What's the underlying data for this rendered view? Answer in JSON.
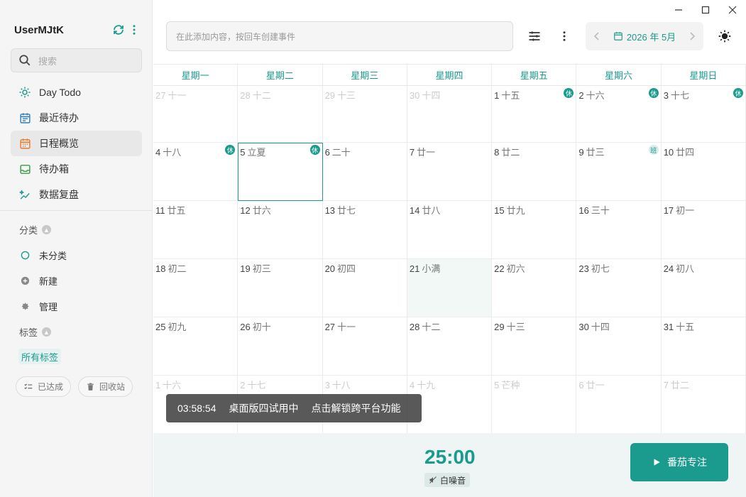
{
  "window": {
    "minimize": "—",
    "maximize": "☐",
    "close": "✕"
  },
  "sidebar": {
    "user": "UserMJtK",
    "search_placeholder": "搜索",
    "nav": [
      {
        "label": "Day Todo",
        "icon": "sun-icon"
      },
      {
        "label": "最近待办",
        "icon": "calendar-list-icon"
      },
      {
        "label": "日程概览",
        "icon": "calendar-grid-icon"
      },
      {
        "label": "待办箱",
        "icon": "inbox-icon"
      },
      {
        "label": "数据复盘",
        "icon": "sparkle-chart-icon"
      }
    ],
    "category_title": "分类",
    "categories": [
      {
        "label": "未分类"
      },
      {
        "label": "新建"
      },
      {
        "label": "管理"
      }
    ],
    "tag_title": "标签",
    "all_tags": "所有标签",
    "done_btn": "已达成",
    "trash_btn": "回收站"
  },
  "topbar": {
    "add_placeholder": "在此添加内容，按回车创建事件",
    "month_label": "2026 年 5月"
  },
  "calendar": {
    "weekdays": [
      "星期一",
      "星期二",
      "星期三",
      "星期四",
      "星期五",
      "星期六",
      "星期日"
    ],
    "days": [
      {
        "n": "27",
        "l": "十一",
        "other": true
      },
      {
        "n": "28",
        "l": "十二",
        "other": true
      },
      {
        "n": "29",
        "l": "十三",
        "other": true
      },
      {
        "n": "30",
        "l": "十四",
        "other": true
      },
      {
        "n": "1",
        "l": "十五",
        "badge": "休"
      },
      {
        "n": "2",
        "l": "十六",
        "badge": "休"
      },
      {
        "n": "3",
        "l": "十七",
        "badge": "休"
      },
      {
        "n": "4",
        "l": "十八",
        "badge": "休"
      },
      {
        "n": "5",
        "l": "立夏",
        "badge": "休",
        "selected": true
      },
      {
        "n": "6",
        "l": "二十"
      },
      {
        "n": "7",
        "l": "廿一"
      },
      {
        "n": "8",
        "l": "廿二"
      },
      {
        "n": "9",
        "l": "廿三",
        "badge": "班",
        "work": true
      },
      {
        "n": "10",
        "l": "廿四"
      },
      {
        "n": "11",
        "l": "廿五"
      },
      {
        "n": "12",
        "l": "廿六"
      },
      {
        "n": "13",
        "l": "廿七"
      },
      {
        "n": "14",
        "l": "廿八"
      },
      {
        "n": "15",
        "l": "廿九"
      },
      {
        "n": "16",
        "l": "三十"
      },
      {
        "n": "17",
        "l": "初一"
      },
      {
        "n": "18",
        "l": "初二"
      },
      {
        "n": "19",
        "l": "初三"
      },
      {
        "n": "20",
        "l": "初四"
      },
      {
        "n": "21",
        "l": "小满",
        "today": true
      },
      {
        "n": "22",
        "l": "初六"
      },
      {
        "n": "23",
        "l": "初七"
      },
      {
        "n": "24",
        "l": "初八"
      },
      {
        "n": "25",
        "l": "初九"
      },
      {
        "n": "26",
        "l": "初十"
      },
      {
        "n": "27",
        "l": "十一"
      },
      {
        "n": "28",
        "l": "十二"
      },
      {
        "n": "29",
        "l": "十三"
      },
      {
        "n": "30",
        "l": "十四"
      },
      {
        "n": "31",
        "l": "十五"
      },
      {
        "n": "1",
        "l": "十六",
        "other": true
      },
      {
        "n": "2",
        "l": "十七",
        "other": true
      },
      {
        "n": "3",
        "l": "十八",
        "other": true
      },
      {
        "n": "4",
        "l": "十九",
        "other": true
      },
      {
        "n": "5",
        "l": "芒种",
        "other": true
      },
      {
        "n": "6",
        "l": "廿一",
        "other": true
      },
      {
        "n": "7",
        "l": "廿二",
        "other": true
      }
    ]
  },
  "toast": {
    "time": "03:58:54",
    "msg1": "桌面版四试用中",
    "msg2": "点击解锁跨平台功能"
  },
  "timer": {
    "time": "25:00",
    "noise": "白噪音",
    "focus_btn": "番茄专注"
  },
  "colors": {
    "accent": "#1a9b8e"
  }
}
